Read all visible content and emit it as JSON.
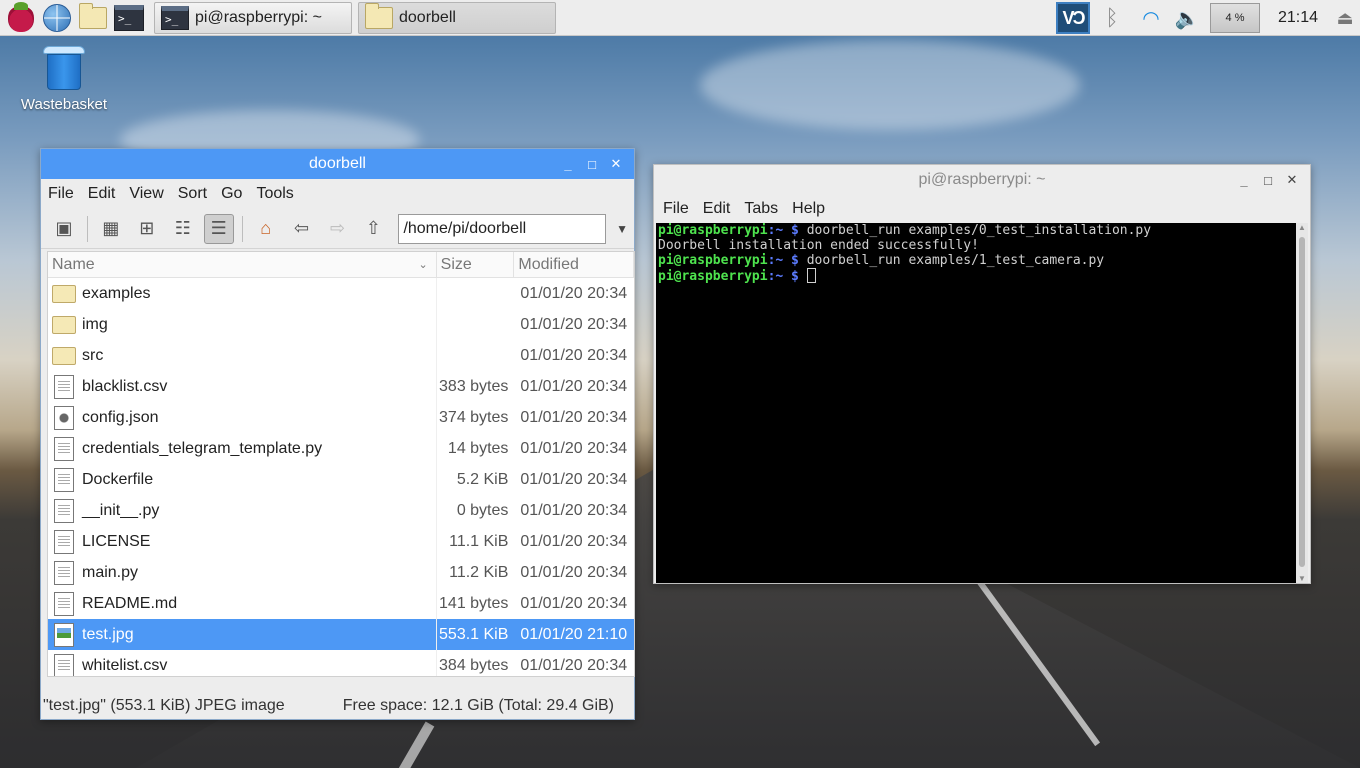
{
  "taskbar": {
    "terminal_launcher_glyph": ">_",
    "tasks": [
      {
        "label": "pi@raspberrypi: ~",
        "icon": "terminal-icon"
      },
      {
        "label": "doorbell",
        "icon": "folder-icon"
      }
    ],
    "vnc_label": "VƆ",
    "cpu_usage": "4 %",
    "clock": "21:14"
  },
  "desktop": {
    "wastebasket_label": "Wastebasket"
  },
  "file_manager": {
    "title": "doorbell",
    "menu": [
      "File",
      "Edit",
      "View",
      "Sort",
      "Go",
      "Tools"
    ],
    "path": "/home/pi/doorbell",
    "columns": {
      "name": "Name",
      "size": "Size",
      "modified": "Modified"
    },
    "rows": [
      {
        "name": "examples",
        "size": "",
        "modified": "01/01/20 20:34",
        "type": "folder"
      },
      {
        "name": "img",
        "size": "",
        "modified": "01/01/20 20:34",
        "type": "folder"
      },
      {
        "name": "src",
        "size": "",
        "modified": "01/01/20 20:34",
        "type": "folder"
      },
      {
        "name": "blacklist.csv",
        "size": "383 bytes",
        "modified": "01/01/20 20:34",
        "type": "doc"
      },
      {
        "name": "config.json",
        "size": "374 bytes",
        "modified": "01/01/20 20:34",
        "type": "cfg"
      },
      {
        "name": "credentials_telegram_template.py",
        "size": "14 bytes",
        "modified": "01/01/20 20:34",
        "type": "doc"
      },
      {
        "name": "Dockerfile",
        "size": "5.2 KiB",
        "modified": "01/01/20 20:34",
        "type": "doc"
      },
      {
        "name": "__init__.py",
        "size": "0 bytes",
        "modified": "01/01/20 20:34",
        "type": "doc"
      },
      {
        "name": "LICENSE",
        "size": "11.1 KiB",
        "modified": "01/01/20 20:34",
        "type": "doc"
      },
      {
        "name": "main.py",
        "size": "11.2 KiB",
        "modified": "01/01/20 20:34",
        "type": "doc"
      },
      {
        "name": "README.md",
        "size": "141 bytes",
        "modified": "01/01/20 20:34",
        "type": "doc"
      },
      {
        "name": "test.jpg",
        "size": "553.1 KiB",
        "modified": "01/01/20 21:10",
        "type": "img",
        "selected": true
      },
      {
        "name": "whitelist.csv",
        "size": "384 bytes",
        "modified": "01/01/20 20:34",
        "type": "doc"
      }
    ],
    "status_left": "\"test.jpg\" (553.1 KiB) JPEG image",
    "status_right": "Free space: 12.1 GiB (Total: 29.4 GiB)",
    "selection_color": "#4d98f5"
  },
  "terminal": {
    "title": "pi@raspberrypi: ~",
    "menu": [
      "File",
      "Edit",
      "Tabs",
      "Help"
    ],
    "lines": [
      {
        "user": "pi@raspberrypi",
        "path": ":~ $",
        "cmd": " doorbell_run examples/0_test_installation.py"
      },
      {
        "output": "Doorbell installation ended successfully!"
      },
      {
        "user": "pi@raspberrypi",
        "path": ":~ $",
        "cmd": " doorbell_run examples/1_test_camera.py"
      },
      {
        "user": "pi@raspberrypi",
        "path": ":~ $",
        "cmd": " ",
        "cursor": true
      }
    ]
  }
}
